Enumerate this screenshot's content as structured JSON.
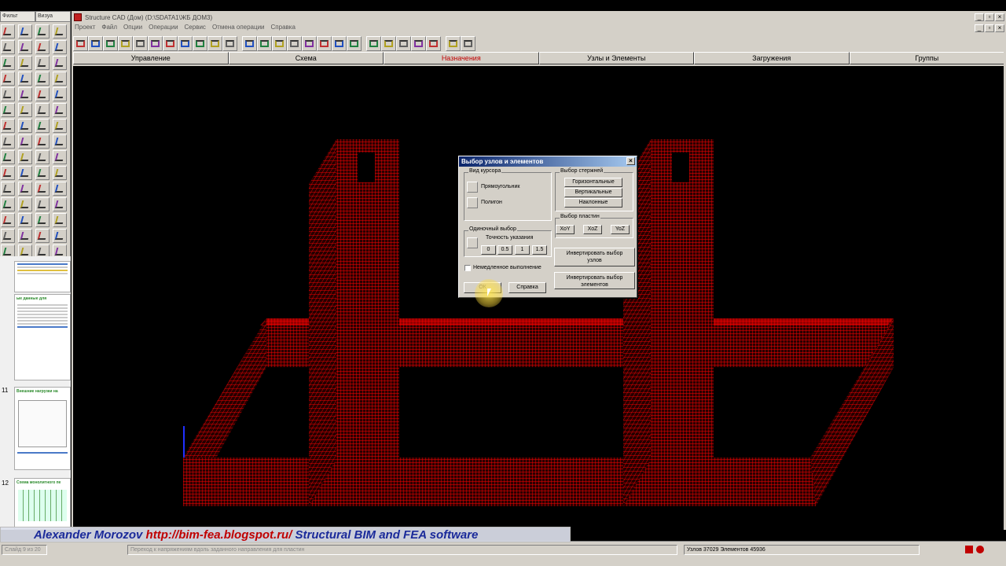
{
  "palette": {
    "tabs": [
      "Фильт",
      "Визуа"
    ]
  },
  "slides": [
    {
      "number": "",
      "title": "ые данные для"
    },
    {
      "number": "11",
      "title": "Внешние нагрузки на"
    },
    {
      "number": "12",
      "title": "Схема монолитного пе"
    }
  ],
  "window": {
    "title": "Structure CAD (Дом) (D:\\SDATA1\\ЖБ ДОМ3)",
    "menu": [
      "Проект",
      "Файл",
      "Опции",
      "Операции",
      "Сервис",
      "Отмена операции",
      "Справка"
    ]
  },
  "tabs": [
    {
      "label": "Управление",
      "active": false
    },
    {
      "label": "Схема",
      "active": false
    },
    {
      "label": "Назначения",
      "active": true
    },
    {
      "label": "Узлы и Элементы",
      "active": false
    },
    {
      "label": "Загружения",
      "active": false
    },
    {
      "label": "Группы",
      "active": false
    }
  ],
  "dialog": {
    "title": "Выбор узлов и элементов",
    "cursor_group": "Вид курсора",
    "rect": "Прямоугольник",
    "poly": "Полигон",
    "single_group": "Одиночный выбор",
    "precision_label": "Точность указания",
    "precision_options": [
      "0",
      "0.5",
      "1",
      "1.5"
    ],
    "immediate": "Немедленное выполнение",
    "rods_group": "Выбор стержней",
    "rods": [
      "Горизонтальные",
      "Вертикальные",
      "Наклонные"
    ],
    "plates_group": "Выбор пластин",
    "plates": [
      "XoY",
      "XoZ",
      "YoZ"
    ],
    "invert_nodes": "Инвертировать выбор узлов",
    "invert_elements": "Инвертировать выбор элементов",
    "ok": "ОК",
    "help": "Справка"
  },
  "banner": {
    "author": "Alexander Morozov",
    "url": "http://bim-fea.blogspot.ru/",
    "tagline": "Structural BIM and FEA software"
  },
  "status": {
    "slide": "Слайд 9 из 20",
    "hint": "Переход к напряжениям вдоль заданного направления для пластин",
    "counts": "Узлов 37029 Элементов 45936"
  },
  "colors": {
    "mesh": "#ff0000",
    "active_tab": "#c00000",
    "banner_text": "#1a2a9a"
  }
}
